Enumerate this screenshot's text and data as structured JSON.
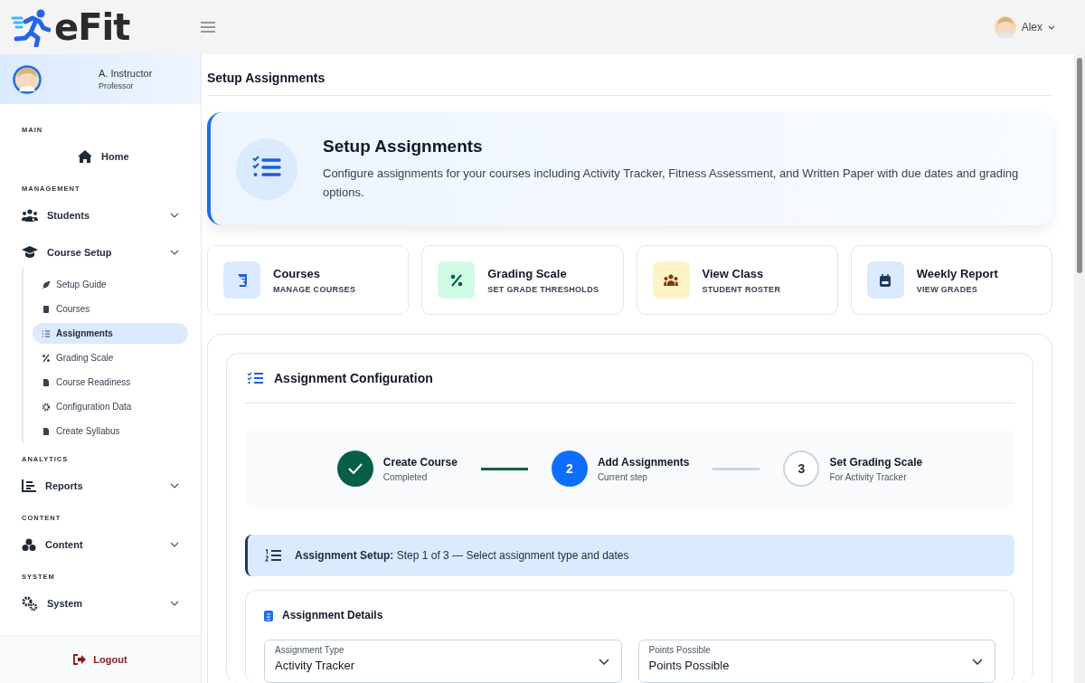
{
  "brand": {
    "name": "eFit"
  },
  "header": {
    "user": "Alex"
  },
  "sidebar": {
    "profile": {
      "name": "A. Instructor",
      "role": "Professor"
    },
    "sections": [
      {
        "label": "MAIN",
        "items": [
          {
            "label": "Home"
          }
        ]
      },
      {
        "label": "MANAGEMENT",
        "items": [
          {
            "label": "Students"
          },
          {
            "label": "Course Setup",
            "expanded": true,
            "children": [
              {
                "label": "Setup Guide",
                "selected": false
              },
              {
                "label": "Courses",
                "selected": false
              },
              {
                "label": "Assignments",
                "selected": true
              },
              {
                "label": "Grading Scale",
                "selected": false
              },
              {
                "label": "Course Readiness",
                "selected": false
              },
              {
                "label": "Configuration Data",
                "selected": false
              },
              {
                "label": "Create Syllabus",
                "selected": false
              }
            ]
          }
        ]
      },
      {
        "label": "ANALYTICS",
        "items": [
          {
            "label": "Reports"
          }
        ]
      },
      {
        "label": "CONTENT",
        "items": [
          {
            "label": "Content"
          }
        ]
      },
      {
        "label": "SYSTEM",
        "items": [
          {
            "label": "System"
          }
        ]
      }
    ],
    "logout": "Logout"
  },
  "page_title": "Setup Assignments",
  "hero": {
    "title": "Setup Assignments",
    "description": "Configure assignments for your courses including Activity Tracker, Fitness Assessment, and Written Paper with due dates and grading options."
  },
  "quick_cards": [
    {
      "title": "Courses",
      "subtitle": "MANAGE COURSES",
      "color": "#dbeafe"
    },
    {
      "title": "Grading Scale",
      "subtitle": "SET GRADE THRESHOLDS",
      "color": "#d1fae5"
    },
    {
      "title": "View Class",
      "subtitle": "STUDENT ROSTER",
      "color": "#fef3c7"
    },
    {
      "title": "Weekly Report",
      "subtitle": "VIEW GRADES",
      "color": "#dbeafe"
    }
  ],
  "config": {
    "title": "Assignment Configuration",
    "steps": [
      {
        "title": "Create Course",
        "subtitle": "Completed",
        "completed": true,
        "current": false
      },
      {
        "number": "2",
        "title": "Add Assignments",
        "subtitle": "Current step",
        "completed": false,
        "current": true
      },
      {
        "number": "3",
        "title": "Set Grading Scale",
        "subtitle": "For Activity Tracker",
        "completed": false,
        "current": false
      }
    ],
    "banner": "**Assignment Setup:** Step 1 of 3 — Select assignment type and dates",
    "details": {
      "title": "Assignment Details",
      "fields": [
        {
          "label": "Assignment Type",
          "value": "Activity Tracker"
        },
        {
          "label": "Points Possible",
          "value": "Points Possible"
        }
      ]
    }
  }
}
